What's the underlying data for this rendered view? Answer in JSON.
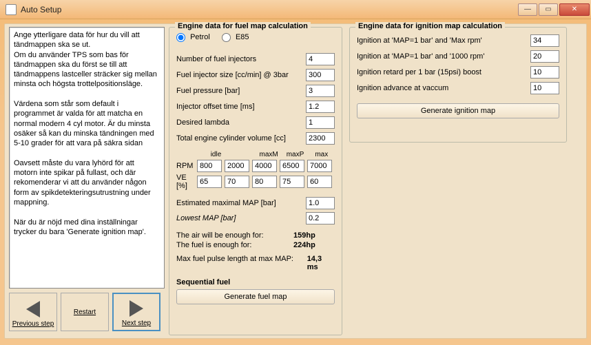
{
  "window": {
    "title": "Auto Setup"
  },
  "instructions": "Ange ytterligare data för hur du vill att tändmappen ska se ut.\nOm du använder TPS som bas för tändmappen ska du först se till att tändmappens lastceller sträcker sig mellan minsta och högsta trottelpositionsläge.\n\nVärdena som står som default i programmet är valda för att matcha en normal modern 4 cyl motor. Är du minsta osäker så kan du minska tändningen med 5-10 grader för att vara på säkra sidan\n\nOavsett måste du vara lyhörd för att motorn inte spikar på fullast, och där rekomenderar vi att du använder någon form av spikdetekteringsutrustning under mappning.\n\nNär du är nöjd med dina inställningar trycker du bara 'Generate ignition map'.",
  "nav": {
    "prev": "Previous step",
    "restart": "Restart",
    "next": "Next step"
  },
  "fuel": {
    "legend": "Engine data for fuel map calculation",
    "petrol_label": "Petrol",
    "e85_label": "E85",
    "fields": {
      "injectors_lbl": "Number of fuel injectors",
      "injectors": "4",
      "inj_size_lbl": "Fuel injector size [cc/min] @ 3bar",
      "inj_size": "300",
      "pressure_lbl": "Fuel pressure [bar]",
      "pressure": "3",
      "offset_lbl": "Injector offset time [ms]",
      "offset": "1.2",
      "lambda_lbl": "Desired lambda",
      "lambda": "1",
      "cylvol_lbl": "Total engine cylinder volume [cc]",
      "cylvol": "2300"
    },
    "grid": {
      "cols": [
        "idle",
        "",
        "maxM",
        "maxP",
        "max"
      ],
      "rpm_lbl": "RPM",
      "rpm": [
        "800",
        "2000",
        "4000",
        "6500",
        "7000"
      ],
      "ve_lbl": "VE [%]",
      "ve": [
        "65",
        "70",
        "80",
        "75",
        "60"
      ]
    },
    "est": {
      "max_map_lbl": "Estimated maximal MAP [bar]",
      "max_map": "1.0",
      "low_map_lbl": "Lowest MAP [bar]",
      "low_map": "0.2"
    },
    "results": {
      "air_lbl": "The air will be enough for:",
      "air": "159hp",
      "fuel_lbl": "The fuel is enough for:",
      "fuel": "224hp",
      "pulse_lbl": "Max fuel pulse length at max MAP:",
      "pulse": "14,3 ms"
    },
    "seq_lbl": "Sequential fuel",
    "gen_btn": "Generate fuel map"
  },
  "ignition": {
    "legend": "Engine data for ignition map calculation",
    "f1_lbl": "Ignition at 'MAP=1 bar' and 'Max rpm'",
    "f1": "34",
    "f2_lbl": "Ignition at 'MAP=1 bar' and '1000 rpm'",
    "f2": "20",
    "f3_lbl": "Ignition retard per 1 bar (15psi) boost",
    "f3": "10",
    "f4_lbl": "Ignition advance at vaccum",
    "f4": "10",
    "gen_btn": "Generate ignition map"
  }
}
